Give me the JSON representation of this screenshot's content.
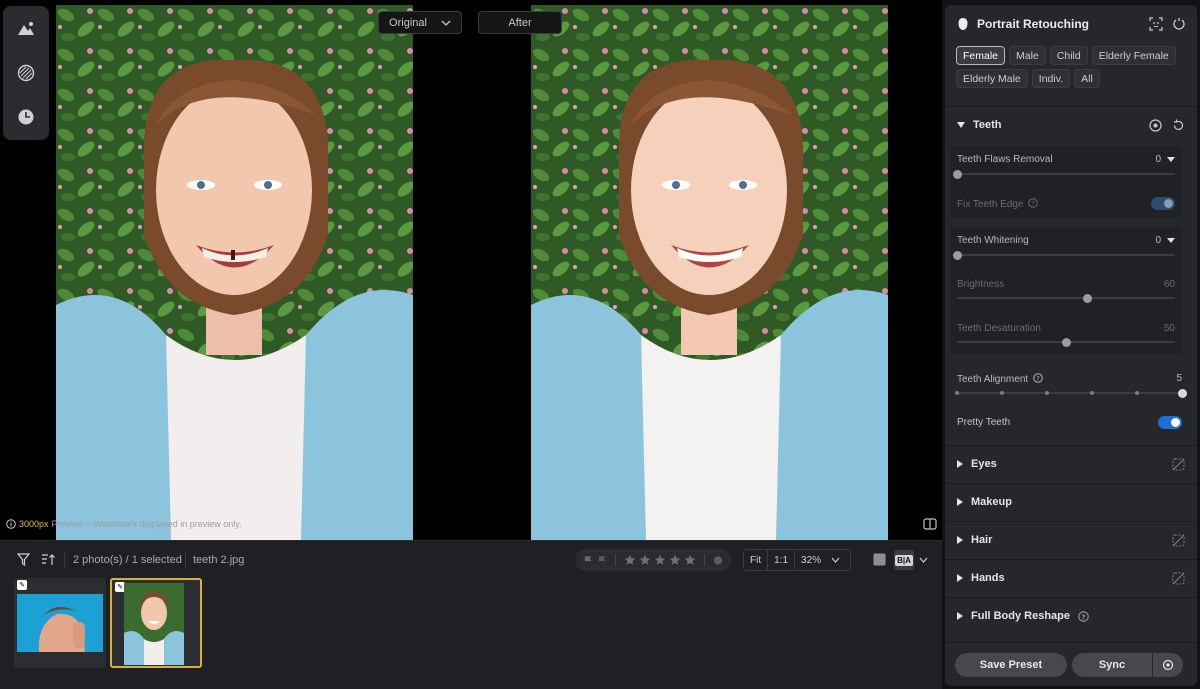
{
  "viewer": {
    "left_tools": [
      "landscape-icon",
      "texture-icon",
      "history-icon"
    ],
    "original_label": "Original",
    "after_label": "After",
    "watermark_px": "3000px",
    "watermark_text": "Preview – Watermark displayed in preview only."
  },
  "bottom": {
    "photo_count": "2 photo(s) / 1 selected",
    "file_name": "teeth 2.jpg",
    "stars": 5,
    "zoom": {
      "fit": "Fit",
      "one_to_one": "1:1",
      "percent": "32%"
    },
    "ba_label": "B|A"
  },
  "panel": {
    "title": "Portrait Retouching",
    "chips": [
      {
        "label": "Female",
        "active": true
      },
      {
        "label": "Male",
        "active": false
      },
      {
        "label": "Child",
        "active": false
      },
      {
        "label": "Elderly Female",
        "active": false
      },
      {
        "label": "Elderly Male",
        "active": false
      },
      {
        "label": "Indiv.",
        "active": false
      },
      {
        "label": "All",
        "active": false
      }
    ],
    "teeth": {
      "title": "Teeth",
      "flaws_label": "Teeth Flaws Removal",
      "flaws_value": "0",
      "fix_edge_label": "Fix Teeth Edge",
      "whitening_label": "Teeth Whitening",
      "whitening_value": "0",
      "brightness_label": "Brightness",
      "brightness_value": "60",
      "desaturation_label": "Teeth Desaturation",
      "desaturation_value": "50",
      "alignment_label": "Teeth Alignment",
      "alignment_value": "5",
      "pretty_label": "Pretty Teeth"
    },
    "sections": {
      "eyes": "Eyes",
      "makeup": "Makeup",
      "hair": "Hair",
      "hands": "Hands",
      "full_body": "Full Body Reshape"
    },
    "footer": {
      "save_preset": "Save Preset",
      "sync": "Sync"
    }
  }
}
